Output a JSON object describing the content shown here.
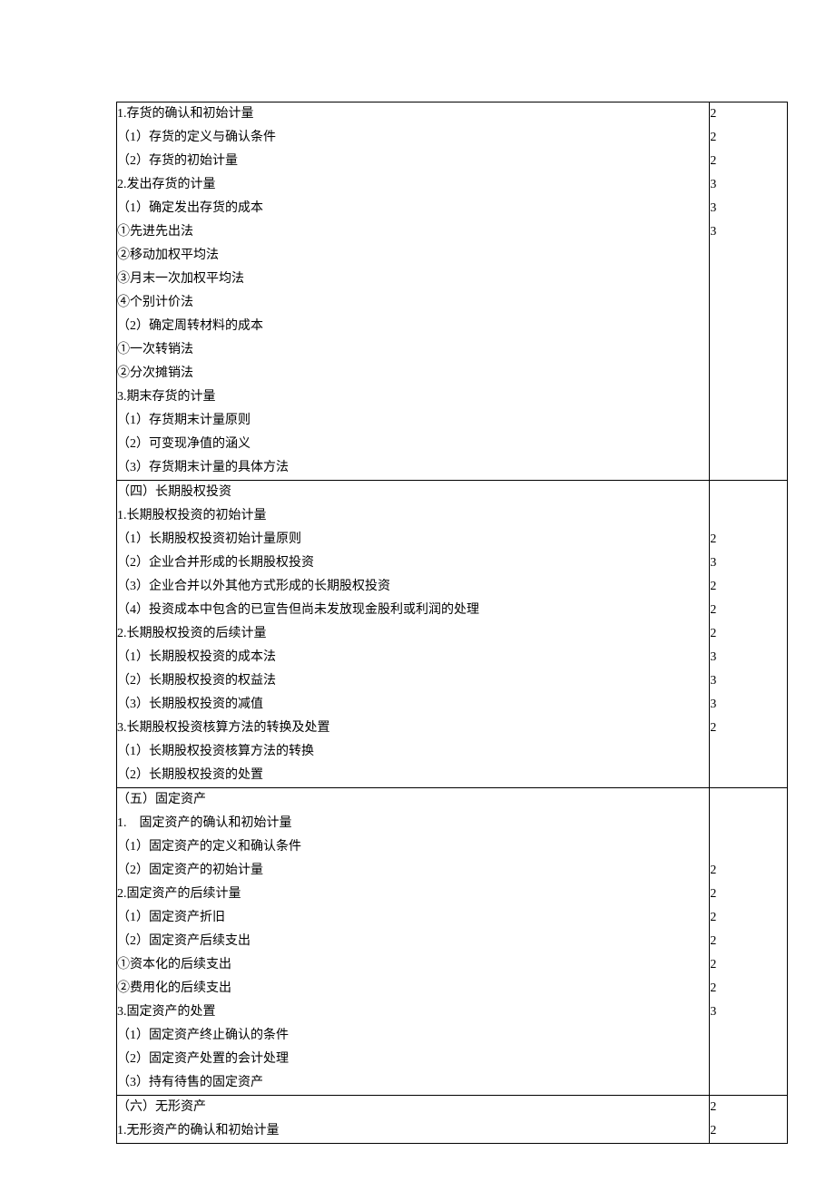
{
  "rows": [
    {
      "t": "1.存货的确认和初始计量",
      "v": "2",
      "top": true
    },
    {
      "t": "（1）存货的定义与确认条件",
      "v": "2"
    },
    {
      "t": "（2）存货的初始计量",
      "v": "2"
    },
    {
      "t": "2.发出存货的计量",
      "v": "3"
    },
    {
      "t": "（1）确定发出存货的成本",
      "v": "3"
    },
    {
      "t": "①先进先出法",
      "v": "3"
    },
    {
      "t": "②移动加权平均法",
      "v": ""
    },
    {
      "t": "③月末一次加权平均法",
      "v": ""
    },
    {
      "t": "④个别计价法",
      "v": ""
    },
    {
      "t": "（2）确定周转材料的成本",
      "v": ""
    },
    {
      "t": "①一次转销法",
      "v": ""
    },
    {
      "t": "②分次摊销法",
      "v": ""
    },
    {
      "t": "3.期末存货的计量",
      "v": ""
    },
    {
      "t": "（1）存货期末计量原则",
      "v": ""
    },
    {
      "t": "（2）可变现净值的涵义",
      "v": ""
    },
    {
      "t": "（3）存货期末计量的具体方法",
      "v": ""
    },
    {
      "t": "（四）长期股权投资",
      "v": "",
      "top": true
    },
    {
      "t": "1.长期股权投资的初始计量",
      "v": ""
    },
    {
      "t": "（1）长期股权投资初始计量原则",
      "v": "2"
    },
    {
      "t": "（2）企业合并形成的长期股权投资",
      "v": "3"
    },
    {
      "t": "（3）企业合并以外其他方式形成的长期股权投资",
      "v": "2"
    },
    {
      "t": "（4）投资成本中包含的已宣告但尚未发放现金股利或利润的处理",
      "v": "2"
    },
    {
      "t": "2.长期股权投资的后续计量",
      "v": "2"
    },
    {
      "t": "（1）长期股权投资的成本法",
      "v": "3"
    },
    {
      "t": "（2）长期股权投资的权益法",
      "v": "3"
    },
    {
      "t": "（3）长期股权投资的减值",
      "v": "3"
    },
    {
      "t": "3.长期股权投资核算方法的转换及处置",
      "v": "2"
    },
    {
      "t": "（1）长期股权投资核算方法的转换",
      "v": ""
    },
    {
      "t": "（2）长期股权投资的处置",
      "v": ""
    },
    {
      "t": "（五）固定资产",
      "v": "",
      "top": true
    },
    {
      "t": "1.　固定资产的确认和初始计量",
      "v": ""
    },
    {
      "t": "（1）固定资产的定义和确认条件",
      "v": ""
    },
    {
      "t": "（2）固定资产的初始计量",
      "v": "2"
    },
    {
      "t": "2.固定资产的后续计量",
      "v": "2"
    },
    {
      "t": "（1）固定资产折旧",
      "v": "2"
    },
    {
      "t": "（2）固定资产后续支出",
      "v": "2"
    },
    {
      "t": "①资本化的后续支出",
      "v": "2"
    },
    {
      "t": "②费用化的后续支出",
      "v": "2"
    },
    {
      "t": "3.固定资产的处置",
      "v": "3"
    },
    {
      "t": "（1）固定资产终止确认的条件",
      "v": ""
    },
    {
      "t": "（2）固定资产处置的会计处理",
      "v": ""
    },
    {
      "t": "（3）持有待售的固定资产",
      "v": ""
    },
    {
      "t": "（六）无形资产",
      "v": "2",
      "top": true
    },
    {
      "t": "1.无形资产的确认和初始计量",
      "v": "2",
      "bottom": true
    }
  ]
}
